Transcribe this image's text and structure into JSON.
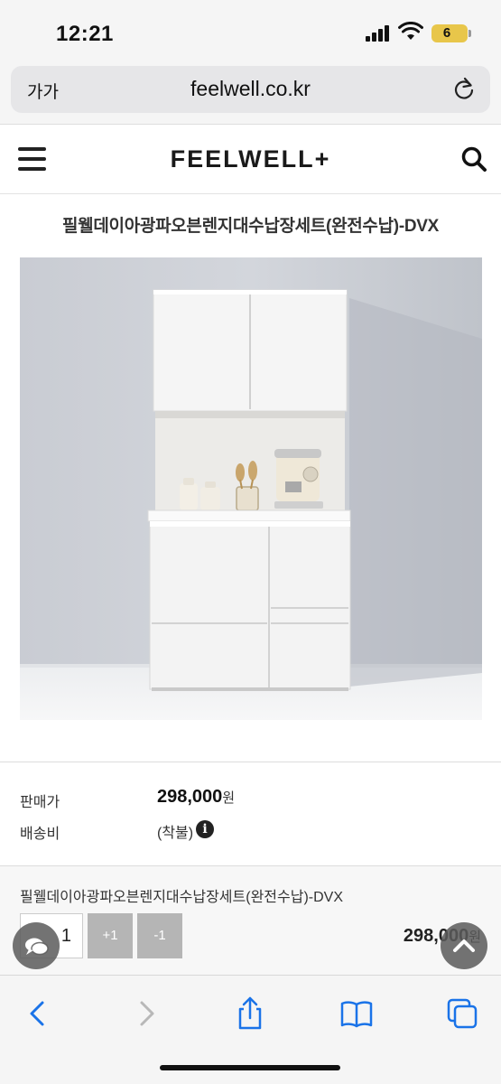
{
  "status_bar": {
    "time": "12:21",
    "battery": "6"
  },
  "browser": {
    "text_size_button": "가가",
    "url": "feelwell.co.kr"
  },
  "site_header": {
    "logo": "FEELWELL+"
  },
  "product": {
    "title": "필웰데이아광파오븐렌지대수납장세트(완전수납)-DVX",
    "price_label": "판매가",
    "price_value": "298,000",
    "price_unit": "원",
    "shipping_label": "배송비",
    "shipping_value": "(착불)",
    "info_icon": "i"
  },
  "option": {
    "name": "필웰데이아광파오븐렌지대수납장세트(완전수납)-DVX",
    "quantity": "1",
    "plus_label": "+1",
    "minus_label": "-1",
    "price_value": "298,000",
    "price_unit": "원"
  },
  "colors": {
    "battery": "#e8c64a",
    "browser_blue": "#1a73e8",
    "button_gray": "#b5b5b5"
  },
  "icons": {
    "url_bar": "reload-icon",
    "header_left": "hamburger-menu-icon",
    "header_right": "search-icon",
    "floating_left": "chat-bubble-icon",
    "floating_right": "chevron-up-icon",
    "toolbar": [
      "back-icon",
      "forward-icon",
      "share-icon",
      "bookmarks-icon",
      "tabs-icon"
    ]
  }
}
